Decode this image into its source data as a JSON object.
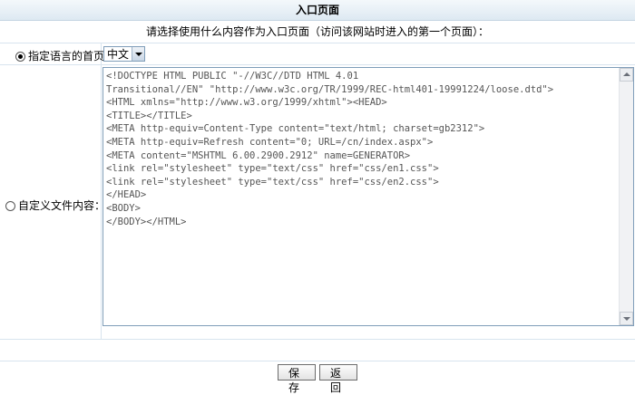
{
  "page": {
    "title": "入口页面",
    "prompt": "请选择使用什么内容作为入口页面（访问该网站时进入的第一个页面）："
  },
  "options": {
    "language_home_label": "指定语言的首页",
    "language_home_checked": true,
    "language_selected": "中文",
    "custom_file_label": "自定义文件内容：",
    "custom_file_checked": false
  },
  "editor": {
    "content": "<!DOCTYPE HTML PUBLIC \"-//W3C//DTD HTML 4.01\nTransitional//EN\" \"http://www.w3c.org/TR/1999/REC-html401-19991224/loose.dtd\">\n<HTML xmlns=\"http://www.w3.org/1999/xhtml\"><HEAD>\n<TITLE></TITLE>\n<META http-equiv=Content-Type content=\"text/html; charset=gb2312\">\n<META http-equiv=Refresh content=\"0; URL=/cn/index.aspx\">\n<META content=\"MSHTML 6.00.2900.2912\" name=GENERATOR>\n<link rel=\"stylesheet\" type=\"text/css\" href=\"css/en1.css\">\n<link rel=\"stylesheet\" type=\"text/css\" href=\"css/en2.css\">\n</HEAD>\n<BODY>\n</BODY></HTML>"
  },
  "buttons": {
    "save": "保存",
    "back": "返回"
  },
  "icons": {
    "select_arrow": "chevron-down-icon",
    "scroll_up": "arrow-up-icon",
    "scroll_down": "arrow-down-icon"
  }
}
